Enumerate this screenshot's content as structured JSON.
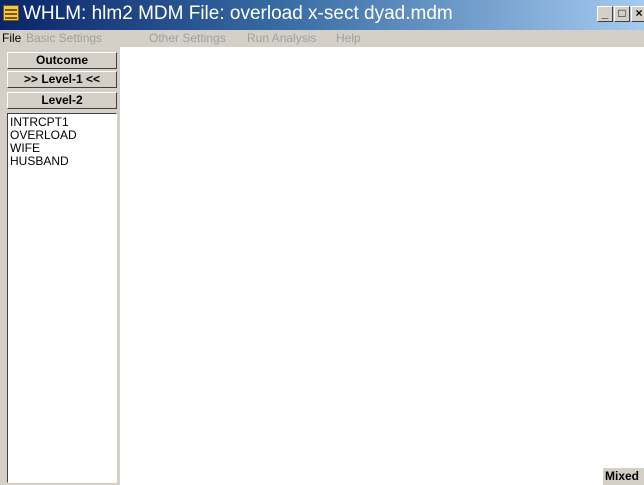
{
  "window": {
    "title": "WHLM: hlm2 MDM File: overload x-sect dyad.mdm",
    "minimize_label": "_",
    "restore_label": "□",
    "close_label": "×"
  },
  "menu": [
    {
      "label": "File",
      "enabled": true
    },
    {
      "label": "Basic Settings",
      "enabled": false
    },
    {
      "label": "Other Settings",
      "enabled": false
    },
    {
      "label": "Run Analysis",
      "enabled": false
    },
    {
      "label": "Help",
      "enabled": false
    }
  ],
  "panel": {
    "buttons": [
      {
        "label": "Outcome"
      },
      {
        "label": ">> Level-1 <<"
      },
      {
        "label": "Level-2"
      }
    ],
    "variables": [
      "INTRCPT1",
      "OVERLOAD",
      "WIFE",
      "HUSBAND"
    ]
  },
  "status": {
    "badge": "Mixed"
  },
  "colors": {
    "titlebar_start": "#0a246a",
    "titlebar_end": "#a6caf0",
    "panel_bg": "#d4d0c8",
    "disabled_text": "#a0a0a0"
  }
}
